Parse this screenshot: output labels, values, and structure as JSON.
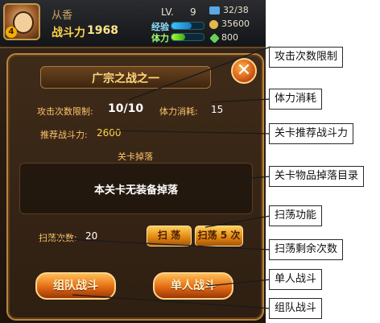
{
  "player": {
    "name": "从香",
    "level_badge": "4",
    "power_label": "战斗力",
    "power_value": "1968",
    "lv_label": "LV.",
    "lv_value": "9",
    "exp_label": "经验",
    "exp_fill": 0.62,
    "stamina_label": "体力",
    "stamina_fill": 0.42
  },
  "resources": [
    {
      "name": "stamina-count",
      "icon": "stamina-icon",
      "value": "32/38",
      "color": "#5aa8e6"
    },
    {
      "name": "coins",
      "icon": "coin-icon",
      "value": "35600",
      "color": "#e6b84a"
    },
    {
      "name": "gems",
      "icon": "gem-icon",
      "value": "800",
      "color": "#6ad05a"
    }
  ],
  "dialog": {
    "title": "广宗之战之一",
    "close_icon": "✕",
    "attack_limit_label": "攻击次数限制:",
    "attack_limit_value": "10/10",
    "stamina_cost_label": "体力消耗:",
    "stamina_cost_value": "15",
    "recommended_power_label": "推荐战斗力:",
    "recommended_power_value": "2600",
    "drop_title": "关卡掉落",
    "drop_text": "本关卡无装备掉落",
    "sweep_count_label": "扫荡次数:",
    "sweep_count_value": "20",
    "sweep_button": "扫 荡",
    "sweep5_button": "扫荡 5 次",
    "team_fight_button": "组队战斗",
    "solo_fight_button": "单人战斗"
  },
  "annotations": [
    "攻击次数限制",
    "体力消耗",
    "关卡推荐战斗力",
    "关卡物品掉落目录",
    "扫荡功能",
    "扫荡剩余次数",
    "单人战斗",
    "组队战斗"
  ]
}
